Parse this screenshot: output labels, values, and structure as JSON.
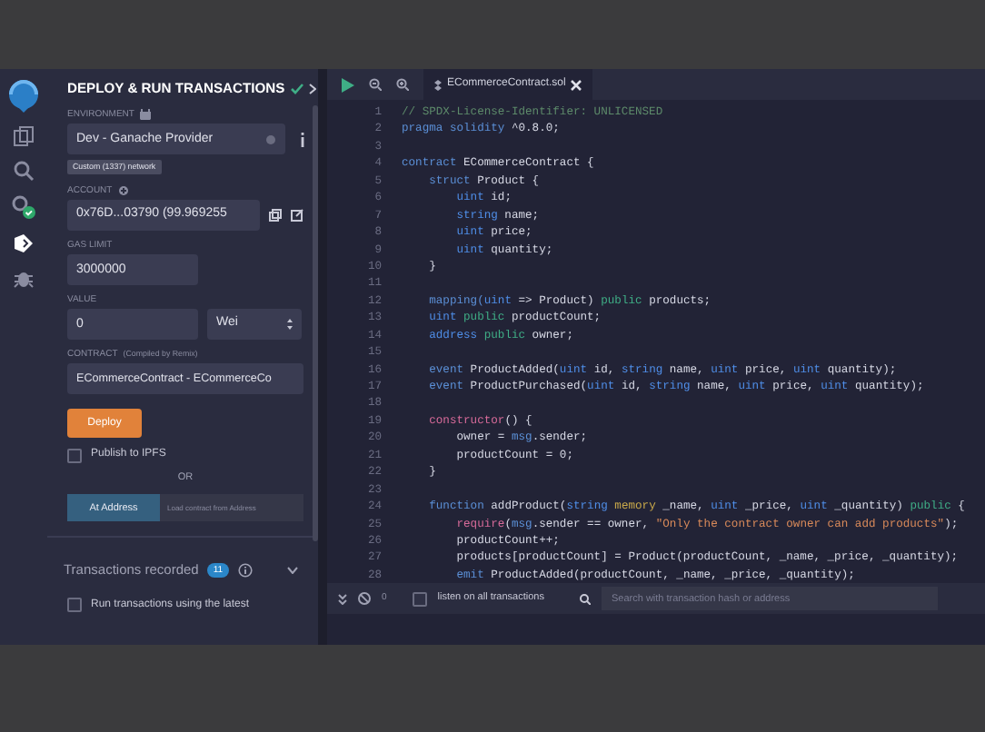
{
  "icon_bar": {
    "items": [
      {
        "kind": "files",
        "selected": false
      },
      {
        "kind": "search",
        "selected": false
      },
      {
        "kind": "compiler",
        "selected": false
      },
      {
        "kind": "deploy",
        "selected": true
      },
      {
        "kind": "debugger",
        "selected": false
      }
    ]
  },
  "panel": {
    "title": "DEPLOY & RUN TRANSACTIONS",
    "environment": {
      "label": "ENVIRONMENT",
      "value": "Dev - Ganache Provider",
      "network": "Custom (1337) network"
    },
    "account": {
      "label": "ACCOUNT",
      "value": "0x76D...03790 (99.969255"
    },
    "gas_limit": {
      "label": "GAS LIMIT",
      "value": "3000000"
    },
    "value": {
      "label": "VALUE",
      "value": "0",
      "unit": "Wei"
    },
    "contract": {
      "label": "CONTRACT",
      "note": "(Compiled by Remix)",
      "value": "ECommerceContract - ECommerceCo"
    },
    "deploy_button": "Deploy",
    "publish": {
      "label": "Publish to IPFS",
      "checked": false
    },
    "or": "OR",
    "at_address": {
      "button": "At Address",
      "placeholder": "Load contract from Address"
    },
    "transactions": {
      "label": "Transactions recorded",
      "count": "11"
    },
    "run_latest": {
      "label": "Run transactions using the latest",
      "checked": false
    }
  },
  "editor": {
    "tab": "ECommerceContract.sol",
    "lines": [
      {
        "number": "1",
        "tokens": [
          {
            "kind": "comment",
            "text": "// SPDX-License-Identifier: UNLICENSED"
          }
        ]
      },
      {
        "number": "2",
        "tokens": [
          {
            "kind": "keyword",
            "text": "pragma solidity"
          },
          {
            "kind": "plain",
            "text": " ^0.8.0;"
          }
        ]
      },
      {
        "number": "3"
      },
      {
        "number": "4",
        "tokens": [
          {
            "kind": "keyword",
            "text": "contract"
          },
          {
            "kind": "plain",
            "text": " ECommerceContract {"
          }
        ]
      },
      {
        "number": "5",
        "tokens": [
          {
            "kind": "keyword",
            "text": "    struct"
          },
          {
            "kind": "plain",
            "text": " Product {"
          }
        ]
      },
      {
        "number": "6",
        "tokens": [
          {
            "kind": "type",
            "text": "        uint"
          },
          {
            "kind": "plain",
            "text": " id;"
          }
        ]
      },
      {
        "number": "7",
        "tokens": [
          {
            "kind": "type",
            "text": "        string"
          },
          {
            "kind": "plain",
            "text": " name;"
          }
        ]
      },
      {
        "number": "8",
        "tokens": [
          {
            "kind": "type",
            "text": "        uint"
          },
          {
            "kind": "plain",
            "text": " price;"
          }
        ]
      },
      {
        "number": "9",
        "tokens": [
          {
            "kind": "type",
            "text": "        uint"
          },
          {
            "kind": "plain",
            "text": " quantity;"
          }
        ]
      },
      {
        "number": "10",
        "tokens": [
          {
            "kind": "plain",
            "text": "    }"
          }
        ]
      },
      {
        "number": "11"
      },
      {
        "number": "12",
        "tokens": [
          {
            "kind": "keyword",
            "text": "    mapping("
          },
          {
            "kind": "type",
            "text": "uint"
          },
          {
            "kind": "plain",
            "text": " => Product)"
          },
          {
            "kind": "modifier",
            "text": " public"
          },
          {
            "kind": "plain",
            "text": " products;"
          }
        ]
      },
      {
        "number": "13",
        "tokens": [
          {
            "kind": "type",
            "text": "    uint"
          },
          {
            "kind": "modifier",
            "text": " public"
          },
          {
            "kind": "plain",
            "text": " productCount;"
          }
        ]
      },
      {
        "number": "14",
        "tokens": [
          {
            "kind": "type",
            "text": "    address"
          },
          {
            "kind": "modifier",
            "text": " public"
          },
          {
            "kind": "plain",
            "text": " owner;"
          }
        ]
      },
      {
        "number": "15"
      },
      {
        "number": "16",
        "tokens": [
          {
            "kind": "keyword",
            "text": "    event"
          },
          {
            "kind": "plain",
            "text": " ProductAdded("
          },
          {
            "kind": "type",
            "text": "uint"
          },
          {
            "kind": "plain",
            "text": " id,"
          },
          {
            "kind": "type",
            "text": " string"
          },
          {
            "kind": "plain",
            "text": " name,"
          },
          {
            "kind": "type",
            "text": " uint"
          },
          {
            "kind": "plain",
            "text": " price,"
          },
          {
            "kind": "type",
            "text": " uint"
          },
          {
            "kind": "plain",
            "text": " quantity);"
          }
        ]
      },
      {
        "number": "17",
        "tokens": [
          {
            "kind": "keyword",
            "text": "    event"
          },
          {
            "kind": "plain",
            "text": " ProductPurchased("
          },
          {
            "kind": "type",
            "text": "uint"
          },
          {
            "kind": "plain",
            "text": " id,"
          },
          {
            "kind": "type",
            "text": " string"
          },
          {
            "kind": "plain",
            "text": " name,"
          },
          {
            "kind": "type",
            "text": " uint"
          },
          {
            "kind": "plain",
            "text": " price,"
          },
          {
            "kind": "type",
            "text": " uint"
          },
          {
            "kind": "plain",
            "text": " quantity);"
          }
        ]
      },
      {
        "number": "18"
      },
      {
        "number": "19",
        "tokens": [
          {
            "kind": "special",
            "text": "    constructor"
          },
          {
            "kind": "plain",
            "text": "() {"
          }
        ]
      },
      {
        "number": "20",
        "tokens": [
          {
            "kind": "plain",
            "text": "        owner = "
          },
          {
            "kind": "keyword",
            "text": "msg"
          },
          {
            "kind": "plain",
            "text": ".sender;"
          }
        ]
      },
      {
        "number": "21",
        "tokens": [
          {
            "kind": "plain",
            "text": "        productCount = 0;"
          }
        ]
      },
      {
        "number": "22",
        "tokens": [
          {
            "kind": "plain",
            "text": "    }"
          }
        ]
      },
      {
        "number": "23"
      },
      {
        "number": "24",
        "tokens": [
          {
            "kind": "keyword",
            "text": "    function"
          },
          {
            "kind": "plain",
            "text": " addProduct("
          },
          {
            "kind": "type",
            "text": "string"
          },
          {
            "kind": "storage",
            "text": " memory"
          },
          {
            "kind": "plain",
            "text": " _name,"
          },
          {
            "kind": "type",
            "text": " uint"
          },
          {
            "kind": "plain",
            "text": " _price,"
          },
          {
            "kind": "type",
            "text": " uint"
          },
          {
            "kind": "plain",
            "text": " _quantity)"
          },
          {
            "kind": "modifier",
            "text": " public"
          },
          {
            "kind": "plain",
            "text": " {"
          }
        ]
      },
      {
        "number": "25",
        "tokens": [
          {
            "kind": "special",
            "text": "        require"
          },
          {
            "kind": "plain",
            "text": "("
          },
          {
            "kind": "keyword",
            "text": "msg"
          },
          {
            "kind": "plain",
            "text": ".sender == owner, "
          },
          {
            "kind": "string",
            "text": "\"Only the contract owner can add products\""
          },
          {
            "kind": "plain",
            "text": ");"
          }
        ]
      },
      {
        "number": "26",
        "tokens": [
          {
            "kind": "plain",
            "text": "        productCount++;"
          }
        ]
      },
      {
        "number": "27",
        "tokens": [
          {
            "kind": "plain",
            "text": "        products[productCount] = Product(productCount, _name, _price, _quantity);"
          }
        ]
      },
      {
        "number": "28",
        "tokens": [
          {
            "kind": "keyword",
            "text": "        emit"
          },
          {
            "kind": "plain",
            "text": " ProductAdded(productCount, _name, _price, _quantity);"
          }
        ]
      }
    ]
  },
  "terminal": {
    "count": "0",
    "listen": {
      "label": "listen on all transactions",
      "checked": false
    },
    "search": {
      "placeholder": "Search with transaction hash or address"
    }
  }
}
